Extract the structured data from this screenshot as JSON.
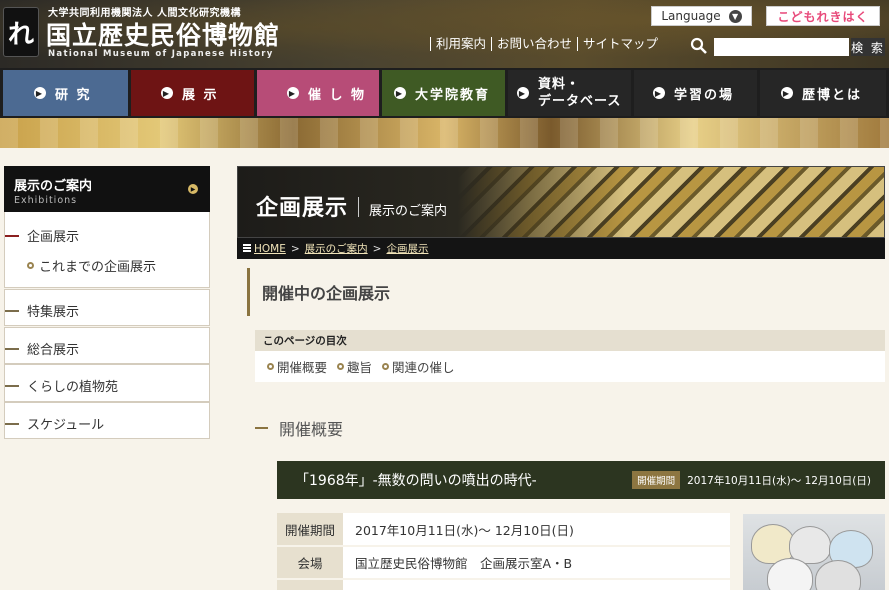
{
  "header": {
    "logo_sub": "大学共同利用機関法人 人間文化研究機構",
    "logo_title": "国立歴史民俗博物館",
    "logo_en": "National Museum of Japanese History",
    "language_label": "Language",
    "kids_label": "こどもれきはく",
    "utility_links": [
      "利用案内",
      "お問い合わせ",
      "サイトマップ"
    ],
    "search_placeholder": "",
    "search_button": "検 索"
  },
  "nav": {
    "items": [
      {
        "label": "研 究",
        "color": "#4c6a92"
      },
      {
        "label": "展 示",
        "color": "#6e1414"
      },
      {
        "label": "催 し 物",
        "color": "#b74c77"
      },
      {
        "label": "大学院教育",
        "color": "#3f5a24"
      },
      {
        "label_1": "資料・",
        "label_2": "データベース",
        "color": "#262626"
      },
      {
        "label": "学習の場",
        "color": "#262626"
      },
      {
        "label": "歴博とは",
        "color": "#262626"
      }
    ]
  },
  "sidebar": {
    "header_jp": "展示のご案内",
    "header_en": "Exhibitions",
    "current": "企画展示",
    "sub_item": "これまでの企画展示",
    "items": [
      "特集展示",
      "総合展示",
      "くらしの植物苑",
      "スケジュール"
    ]
  },
  "main": {
    "title": "企画展示",
    "subtitle": "展示のご案内",
    "breadcrumb": [
      "HOME",
      "展示のご案内",
      "企画展示"
    ],
    "section_title": "開催中の企画展示",
    "toc_title": "このページの目次",
    "toc_links": [
      "開催概要",
      "趣旨",
      "関連の催し"
    ],
    "overview_title": "開催概要",
    "exhibit": {
      "title": "「1968年」-無数の問いの噴出の時代-",
      "period_badge": "開催期間",
      "period": "2017年10月11日(水)～ 12月10日(日)"
    },
    "table": [
      {
        "key": "開催期間",
        "value": "2017年10月11日(水)～ 12月10日(日)"
      },
      {
        "key": "会場",
        "value": "国立歴史民俗博物館　企画展示室A・B"
      }
    ]
  }
}
